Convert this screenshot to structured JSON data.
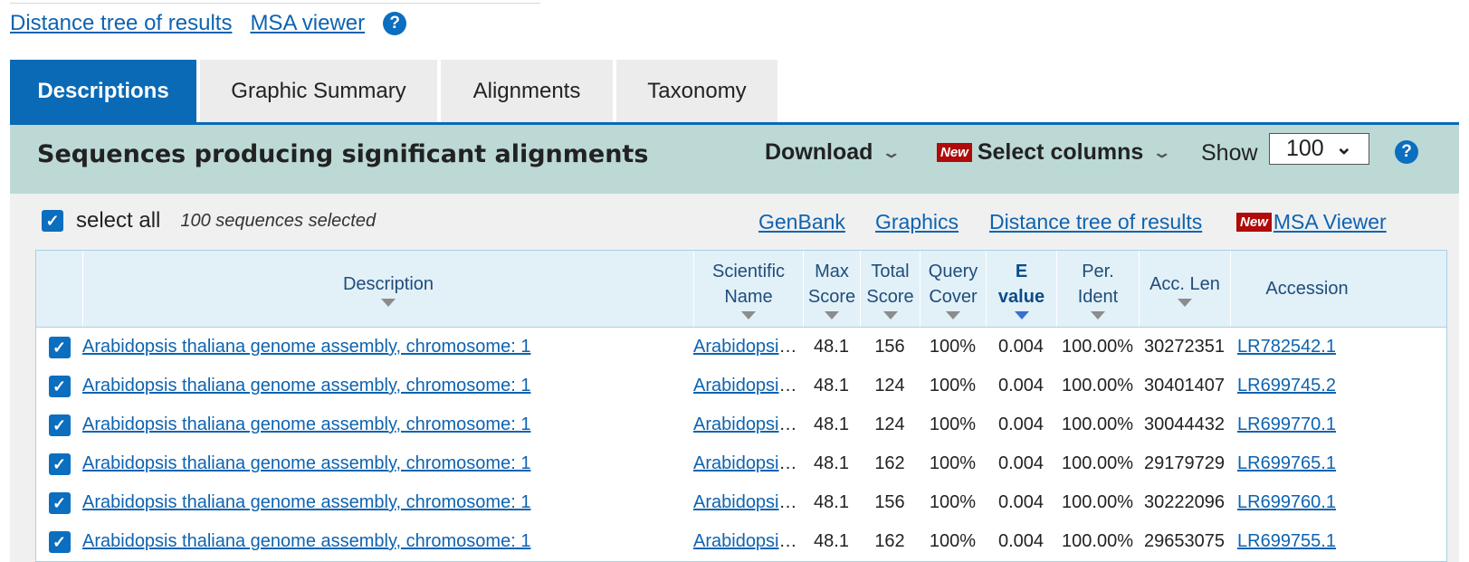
{
  "top_links": {
    "distance_tree": "Distance tree of results",
    "msa_viewer": "MSA viewer",
    "help": "?"
  },
  "tabs": [
    {
      "label": "Descriptions",
      "active": true
    },
    {
      "label": "Graphic Summary",
      "active": false
    },
    {
      "label": "Alignments",
      "active": false
    },
    {
      "label": "Taxonomy",
      "active": false
    }
  ],
  "toolbar": {
    "title": "Sequences producing significant alignments",
    "download_label": "Download",
    "new_badge": "New",
    "select_columns_label": "Select columns",
    "show_label": "Show",
    "show_value": "100",
    "help": "?"
  },
  "selection": {
    "select_all_label": "select all",
    "selected_count": "100 sequences selected",
    "genbank": "GenBank",
    "graphics": "Graphics",
    "distance_tree": "Distance tree of results",
    "new_badge": "New",
    "msa_viewer": "MSA Viewer"
  },
  "table": {
    "headers": {
      "description": "Description",
      "sci_name_1": "Scientific",
      "sci_name_2": "Name",
      "max_score_1": "Max",
      "max_score_2": "Score",
      "total_score_1": "Total",
      "total_score_2": "Score",
      "query_cover_1": "Query",
      "query_cover_2": "Cover",
      "evalue_1": "E",
      "evalue_2": "value",
      "per_ident_1": "Per.",
      "per_ident_2": "Ident",
      "acc_len": "Acc. Len",
      "accession": "Accession"
    },
    "rows": [
      {
        "description": "Arabidopsis thaliana genome assembly, chromosome: 1",
        "sci_name": "Arabidopsis…",
        "max_score": "48.1",
        "total_score": "156",
        "query_cover": "100%",
        "evalue": "0.004",
        "per_ident": "100.00%",
        "acc_len": "30272351",
        "accession": "LR782542.1"
      },
      {
        "description": "Arabidopsis thaliana genome assembly, chromosome: 1",
        "sci_name": "Arabidopsis…",
        "max_score": "48.1",
        "total_score": "124",
        "query_cover": "100%",
        "evalue": "0.004",
        "per_ident": "100.00%",
        "acc_len": "30401407",
        "accession": "LR699745.2"
      },
      {
        "description": "Arabidopsis thaliana genome assembly, chromosome: 1",
        "sci_name": "Arabidopsis…",
        "max_score": "48.1",
        "total_score": "124",
        "query_cover": "100%",
        "evalue": "0.004",
        "per_ident": "100.00%",
        "acc_len": "30044432",
        "accession": "LR699770.1"
      },
      {
        "description": "Arabidopsis thaliana genome assembly, chromosome: 1",
        "sci_name": "Arabidopsis…",
        "max_score": "48.1",
        "total_score": "162",
        "query_cover": "100%",
        "evalue": "0.004",
        "per_ident": "100.00%",
        "acc_len": "29179729",
        "accession": "LR699765.1"
      },
      {
        "description": "Arabidopsis thaliana genome assembly, chromosome: 1",
        "sci_name": "Arabidopsis…",
        "max_score": "48.1",
        "total_score": "156",
        "query_cover": "100%",
        "evalue": "0.004",
        "per_ident": "100.00%",
        "acc_len": "30222096",
        "accession": "LR699760.1"
      },
      {
        "description": "Arabidopsis thaliana genome assembly, chromosome: 1",
        "sci_name": "Arabidopsis…",
        "max_score": "48.1",
        "total_score": "162",
        "query_cover": "100%",
        "evalue": "0.004",
        "per_ident": "100.00%",
        "acc_len": "29653075",
        "accession": "LR699755.1"
      }
    ]
  }
}
